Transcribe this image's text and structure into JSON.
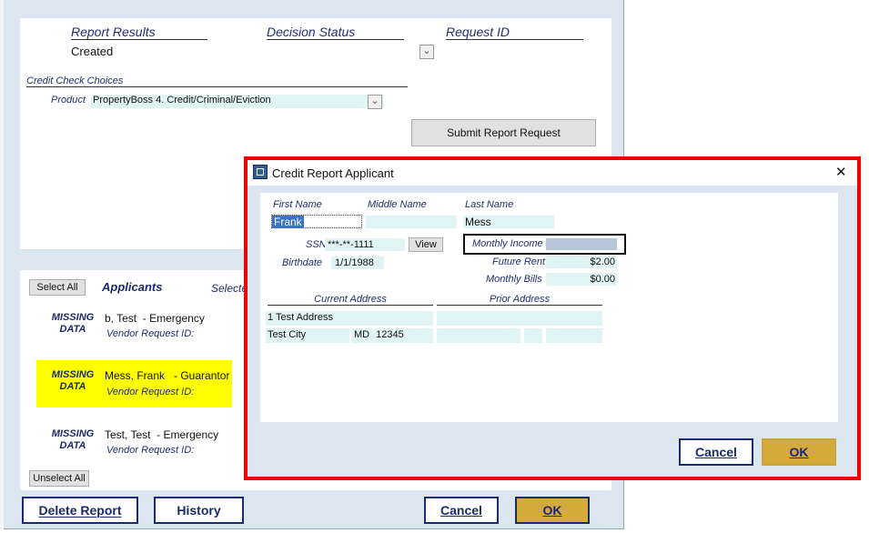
{
  "main": {
    "report_results_label": "Report Results",
    "report_results_value": "Created",
    "decision_status_label": "Decision Status",
    "request_id_label": "Request ID",
    "credit_check_choices_label": "Credit Check Choices",
    "product_label": "Product",
    "product_value": "PropertyBoss 4. Credit/Criminal/Eviction",
    "submit_label": "Submit Report Request",
    "select_all_label": "Select All",
    "applicants_heading": "Applicants",
    "selected_label_partial": "Selecte",
    "unselect_all_label": "Unselect All",
    "delete_report_label": "Delete Report",
    "history_label": "History",
    "cancel_label": "Cancel",
    "ok_label": "OK",
    "applicants": [
      {
        "status": "MISSING\nDATA",
        "name": "b, Test  - Emergency",
        "vendor": "Vendor Request ID:",
        "highlighted": false
      },
      {
        "status": "MISSING\nDATA",
        "name": "Mess, Frank   - Guarantor",
        "vendor": "Vendor Request ID:",
        "highlighted": true
      },
      {
        "status": "MISSING\nDATA",
        "name": "Test, Test  - Emergency",
        "vendor": "Vendor Request ID:",
        "highlighted": false
      }
    ]
  },
  "dialog": {
    "title": "Credit Report Applicant",
    "first_name_label": "First Name",
    "first_name_value": "Frank",
    "middle_name_label": "Middle Name",
    "middle_name_value": "",
    "last_name_label": "Last Name",
    "last_name_value": "Mess",
    "ssn_label": "SSN",
    "ssn_value": "***-**-1111",
    "view_label": "View",
    "birthdate_label": "Birthdate",
    "birthdate_value": "1/1/1988",
    "monthly_income_label": "Monthly Income",
    "monthly_income_value": "",
    "future_rent_label": "Future Rent",
    "future_rent_value": "$2.00",
    "monthly_bills_label": "Monthly Bills",
    "monthly_bills_value": "$0.00",
    "current_address_label": "Current Address",
    "prior_address_label": "Prior Address",
    "current_street": "1 Test Address",
    "current_city": "Test City",
    "current_state": "MD",
    "current_zip": "12345",
    "cancel_label": "Cancel",
    "ok_label": "OK",
    "close_glyph": "✕"
  },
  "colors": {
    "frame_bg": "#dce6f1",
    "highlight": "#ffff00",
    "navy": "#1a2a6e",
    "field": "#e1f4f4",
    "ok_gold": "#d4aa3a",
    "annotation_red": "#ee0000"
  }
}
